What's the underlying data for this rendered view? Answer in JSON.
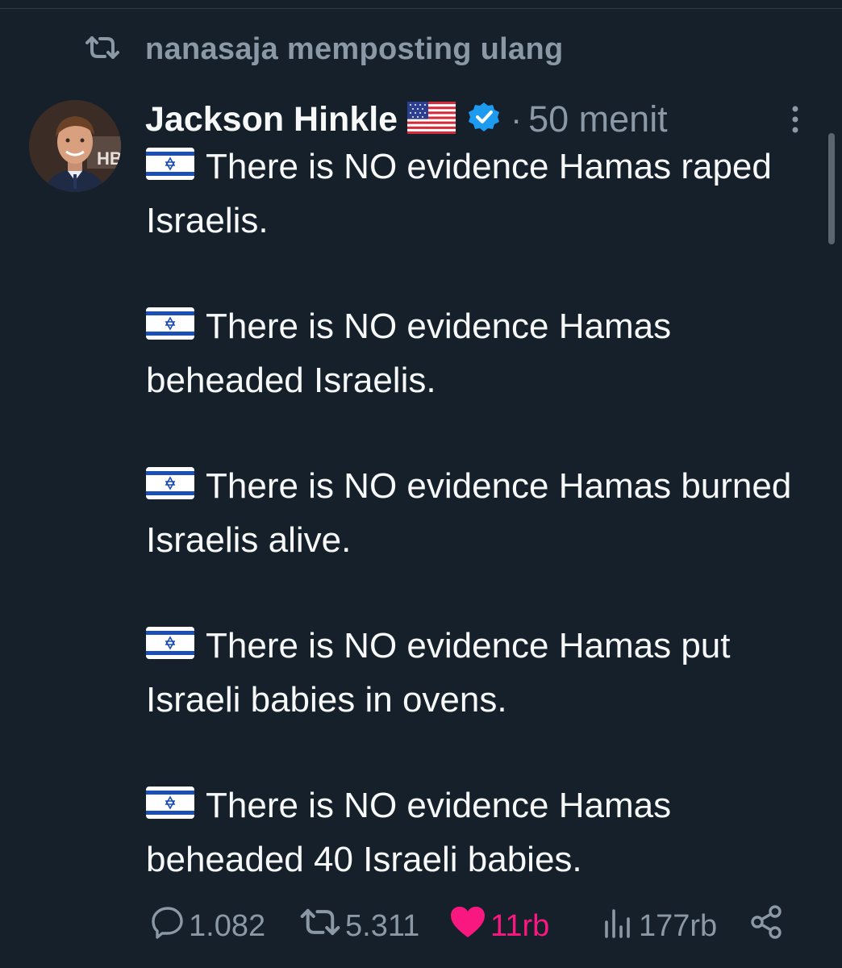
{
  "repost": {
    "icon": "repost-icon",
    "text": "nanasaja memposting ulang"
  },
  "author": {
    "name": "Jackson Hinkle",
    "name_flag": "us-flag-emoji",
    "verified": true,
    "separator": "·",
    "time": "50 menit",
    "avatar": "avatar-photo"
  },
  "post": {
    "flag": "israel-flag-emoji",
    "paragraphs": [
      "There is NO evidence Hamas raped Israelis.",
      "There is NO evidence Hamas beheaded Israelis.",
      "There is NO evidence Hamas burned Israelis alive.",
      "There is NO evidence Hamas put Israeli babies in ovens.",
      "There is NO evidence Hamas beheaded 40 Israeli babies."
    ]
  },
  "actions": {
    "replies": "1.082",
    "reposts": "5.311",
    "likes": "11rb",
    "views": "177rb"
  },
  "colors": {
    "background": "#15202b",
    "text": "#f7f9f9",
    "muted": "#8b98a5",
    "like": "#f91880",
    "verified": "#1d9bf0"
  }
}
